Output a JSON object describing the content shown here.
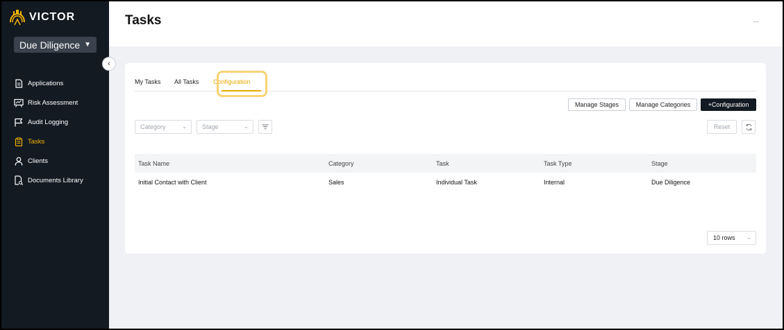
{
  "app": {
    "logo_text": "VICTOR",
    "workspace": "Due Diligence"
  },
  "sidebar": {
    "items": [
      {
        "label": "Applications",
        "icon": "document-icon"
      },
      {
        "label": "Risk Assessment",
        "icon": "chart-board-icon"
      },
      {
        "label": "Audit Logging",
        "icon": "flag-icon"
      },
      {
        "label": "Tasks",
        "icon": "clipboard-icon",
        "active": true
      },
      {
        "label": "Clients",
        "icon": "user-icon"
      },
      {
        "label": "Documents Library",
        "icon": "document-search-icon"
      }
    ]
  },
  "header": {
    "title": "Tasks",
    "more": "..."
  },
  "tabs": [
    {
      "label": "My Tasks"
    },
    {
      "label": "All Tasks"
    },
    {
      "label": "Configuration",
      "active": true
    }
  ],
  "actions": {
    "manage_stages": "Manage Stages",
    "manage_categories": "Manage Categories",
    "add_configuration": "+Configuration",
    "reset": "Reset"
  },
  "filters": {
    "category_placeholder": "Category",
    "stage_placeholder": "Stage"
  },
  "table": {
    "columns": [
      "Task Name",
      "Category",
      "Task",
      "Task Type",
      "Stage"
    ],
    "rows": [
      [
        "Initial Contact with Client",
        "Sales",
        "Individual Task",
        "Internal",
        "Due Diligence"
      ]
    ]
  },
  "pagination": {
    "rows_per_page": "10 rows"
  },
  "colors": {
    "accent": "#e8a800",
    "sidebar_bg": "#131a22",
    "highlight": "#f9d474"
  }
}
